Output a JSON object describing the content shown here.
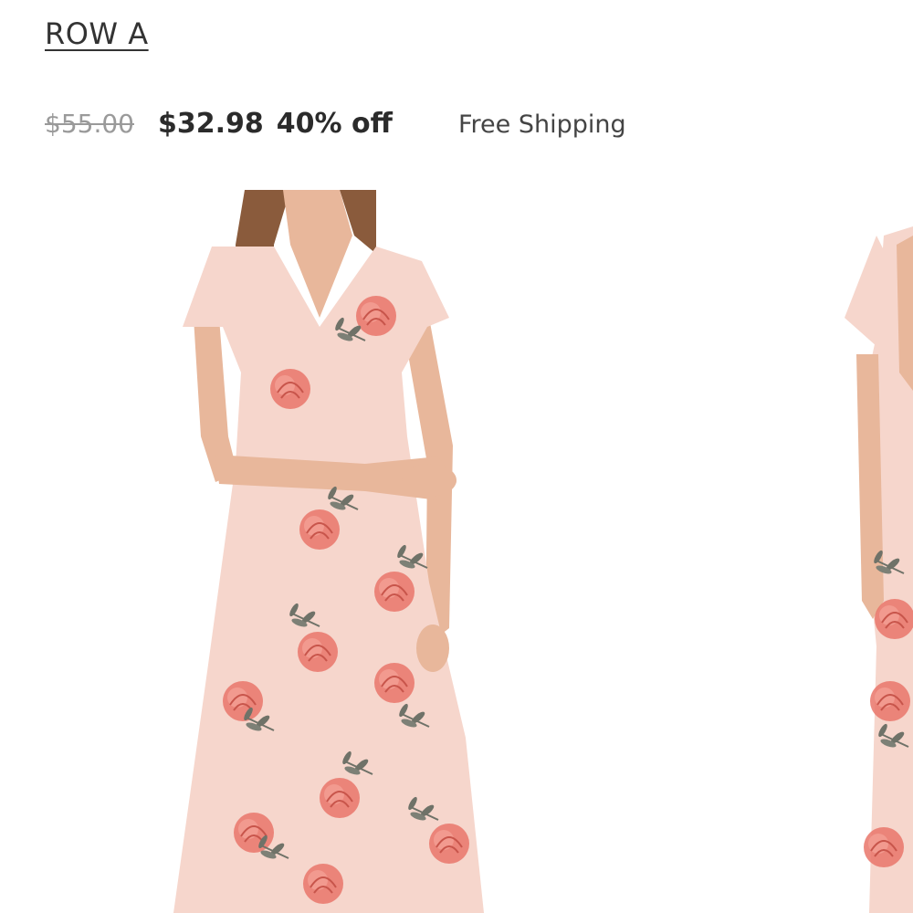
{
  "product": {
    "brand": "ROW A",
    "price": {
      "original": "$55.00",
      "sale": "$32.98",
      "discount": "40% off"
    },
    "shipping": "Free Shipping"
  },
  "gallery": {
    "images": [
      {
        "alt": "Floral maxi dress front view"
      },
      {
        "alt": "Floral maxi dress back view"
      }
    ]
  },
  "colors": {
    "dress": "#f6d6cc",
    "flower": "#e9756a",
    "leaf": "#6f7268",
    "hair": "#8a5b3c",
    "skin": "#e8b79b",
    "text": "#2b2b2b",
    "muted": "#9a9a9a"
  }
}
